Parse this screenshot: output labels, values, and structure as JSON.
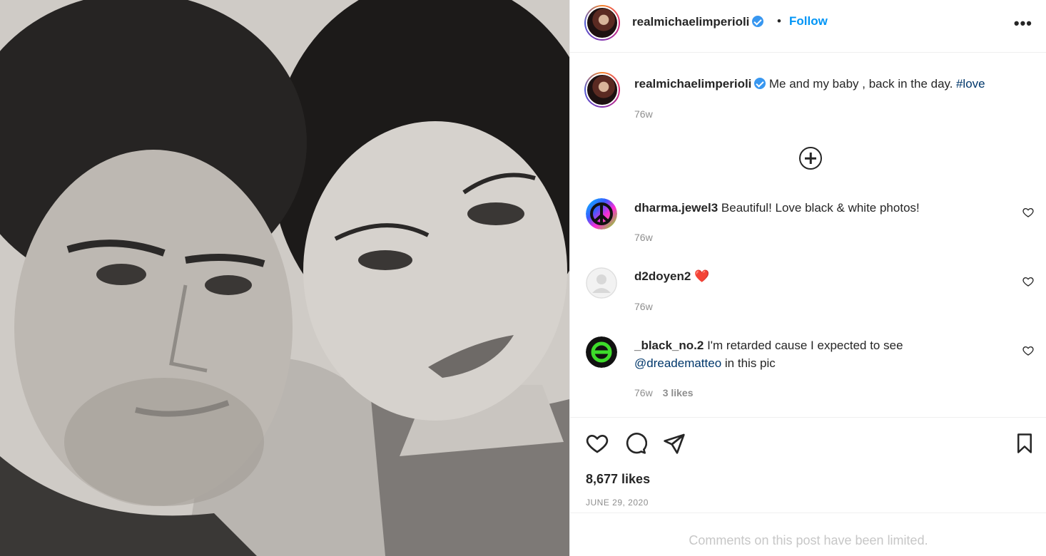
{
  "post": {
    "photo_alt": "Black and white photo of a couple",
    "author": {
      "username": "realmichaelimperioli",
      "verified": true
    },
    "follow_label": "Follow",
    "separator": "•",
    "more_label": "•••",
    "caption": {
      "text": "Me and my baby , back in the day.",
      "hashtag": "#love",
      "time": "76w"
    },
    "comments": [
      {
        "username": "dharma.jewel3",
        "text": "Beautiful! Love black & white photos!",
        "time": "76w",
        "avatar_icon": "peace-sign-icon"
      },
      {
        "username": "d2doyen2",
        "text": "❤️",
        "time": "76w",
        "avatar_icon": "default-avatar-icon"
      },
      {
        "username": "_black_no.2",
        "text": "I'm retarded cause I expected to see",
        "mention": "@dreadematteo",
        "text_after": "in this pic",
        "time": "76w",
        "likes": "3 likes",
        "avatar_icon": "type-o-negative-logo-icon"
      }
    ],
    "likes_count": "8,677 likes",
    "date": "JUNE 29, 2020",
    "comments_limited": "Comments on this post have been limited."
  },
  "colors": {
    "link_blue": "#0095f6",
    "hashtag_blue": "#00376b",
    "muted_gray": "#8e8e8e",
    "heart_red": "#ed4956"
  }
}
